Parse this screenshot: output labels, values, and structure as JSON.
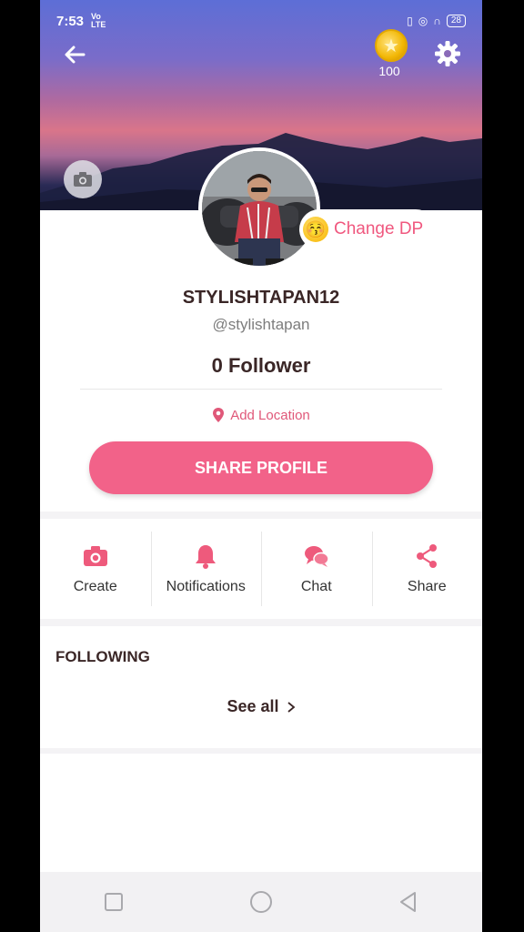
{
  "status_bar": {
    "time": "7:53",
    "network_top": "Vo",
    "network_bottom": "LTE",
    "battery": "28"
  },
  "header": {
    "coin_count": "100"
  },
  "profile": {
    "change_dp_label": "Change DP",
    "username": "STYLISHTAPAN12",
    "handle": "@stylishtapan",
    "followers": "0 Follower",
    "add_location_label": "Add Location",
    "share_button_label": "SHARE PROFILE"
  },
  "actions": [
    {
      "label": "Create",
      "icon": "camera-icon"
    },
    {
      "label": "Notifications",
      "icon": "bell-icon"
    },
    {
      "label": "Chat",
      "icon": "chat-bubbles-icon"
    },
    {
      "label": "Share",
      "icon": "share-icon"
    }
  ],
  "following": {
    "title": "FOLLOWING",
    "see_all_label": "See all"
  },
  "colors": {
    "accent": "#f26289",
    "accent_text": "#e05879",
    "dark_text": "#3a2626"
  }
}
